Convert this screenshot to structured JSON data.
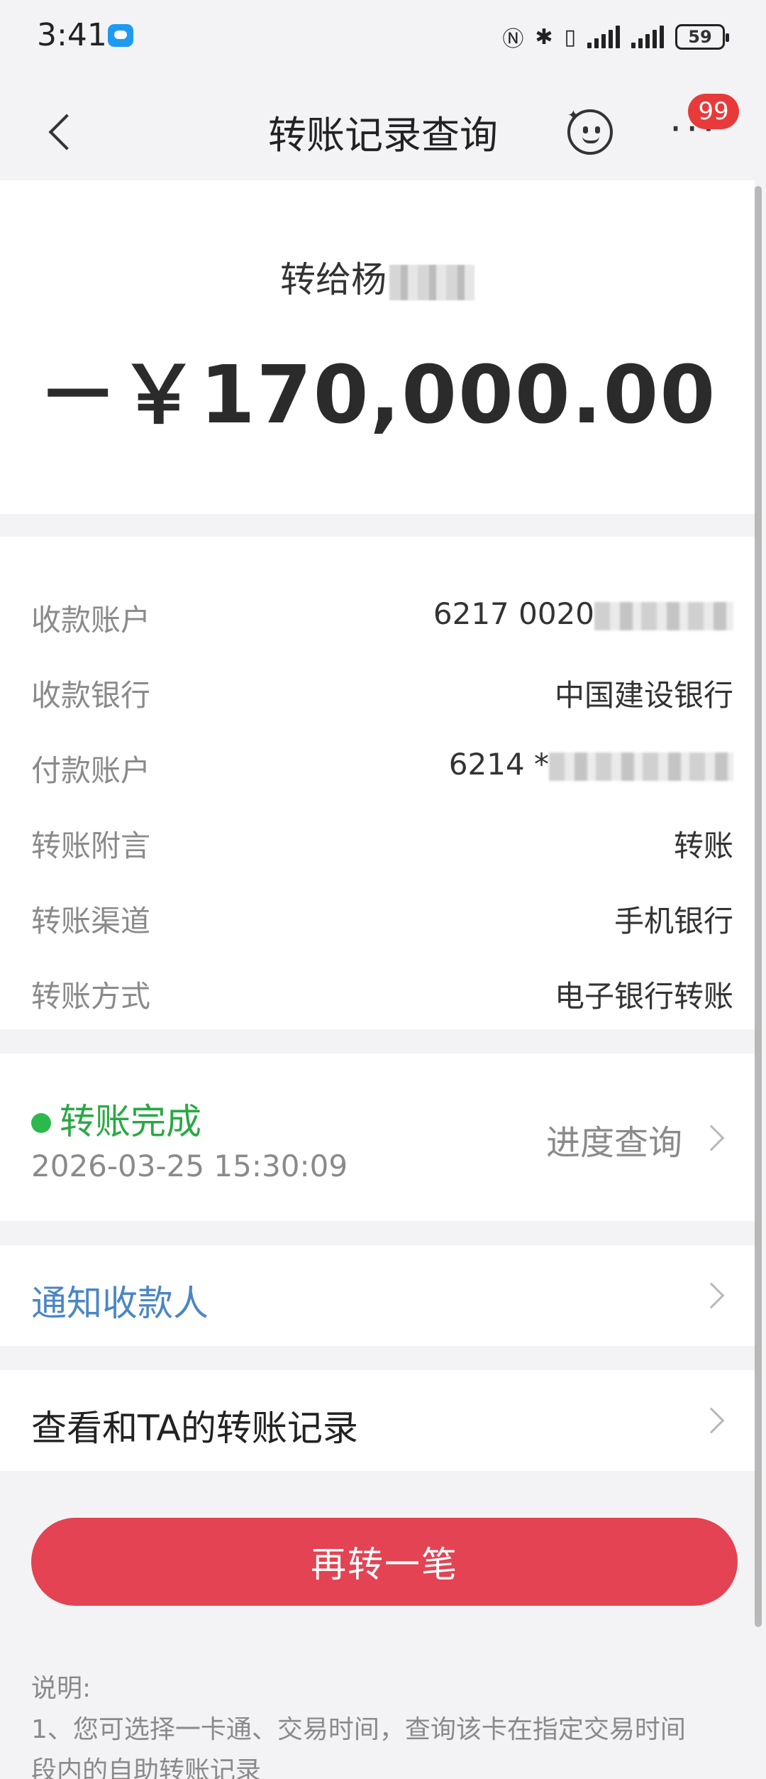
{
  "status_bar": {
    "time": "3:41",
    "battery": "59",
    "icons": [
      "message-icon",
      "nfc-icon",
      "bluetooth-icon",
      "vibrate-icon",
      "signal-icon",
      "signal-icon",
      "battery-icon"
    ]
  },
  "nav": {
    "title": "转账记录查询",
    "badge": "99"
  },
  "hero": {
    "recipient_prefix": "转给杨",
    "amount": "－￥170,000.00"
  },
  "details": [
    {
      "label": "收款账户",
      "value": "6217 0020"
    },
    {
      "label": "收款银行",
      "value": "中国建设银行"
    },
    {
      "label": "付款账户",
      "value": "6214 *"
    },
    {
      "label": "转账附言",
      "value": "转账"
    },
    {
      "label": "转账渠道",
      "value": "手机银行"
    },
    {
      "label": "转账方式",
      "value": "电子银行转账"
    }
  ],
  "status": {
    "text": "转账完成",
    "time": "2026-03-25 15:30:09",
    "link": "进度查询",
    "color": "#2aa845"
  },
  "notify": {
    "label": "通知收款人",
    "color": "#4a86c5"
  },
  "history": {
    "label": "查看和TA的转账记录"
  },
  "action": {
    "label": "再转一笔",
    "color": "#e34352"
  },
  "note": {
    "title": "说明:",
    "line1": "1、您可选择一卡通、交易时间，查询该卡在指定交易时间",
    "line2": "段内的自助转账记录"
  }
}
